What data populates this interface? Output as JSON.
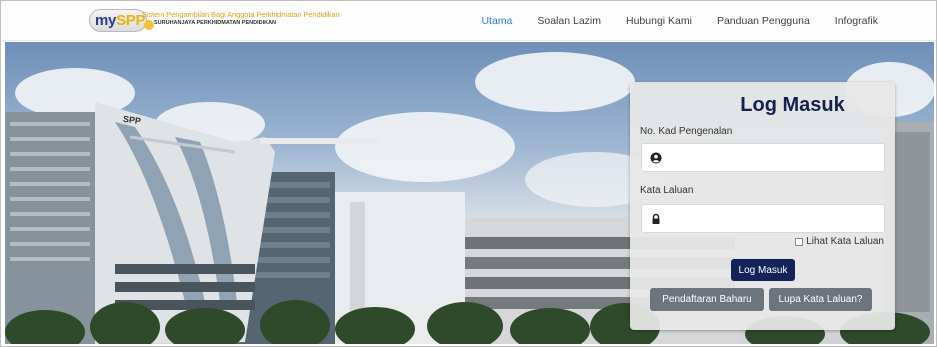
{
  "logo": {
    "my": "my",
    "spp": "SPP",
    "line1": "Sistem Pengambilan Bagi Anggota Perkhidmatan Pendidikan",
    "line2": "SURUHANJAYA PERKHIDMATAN PENDIDIKAN"
  },
  "nav": {
    "items": [
      "Utama",
      "Soalan Lazim",
      "Hubungi Kami",
      "Panduan Pengguna",
      "Infografik"
    ],
    "active": "Utama"
  },
  "building_sign": "SPP",
  "login": {
    "title": "Log Masuk",
    "ic_label": "No. Kad Pengenalan",
    "ic_value": "",
    "password_label": "Kata Laluan",
    "password_value": "",
    "show_password_label": "Lihat Kata Laluan",
    "show_password_checked": false,
    "login_button": "Log Masuk",
    "register_button": "Pendaftaran Baharu",
    "forgot_button": "Lupa Kata Laluan?"
  },
  "colors": {
    "nav_active": "#2b7de0",
    "title": "#15204f",
    "primary_button": "#13235a",
    "secondary_button": "#6c757d"
  },
  "icons": {
    "ic_field": "user-circle-icon",
    "password_field": "lock-icon"
  }
}
